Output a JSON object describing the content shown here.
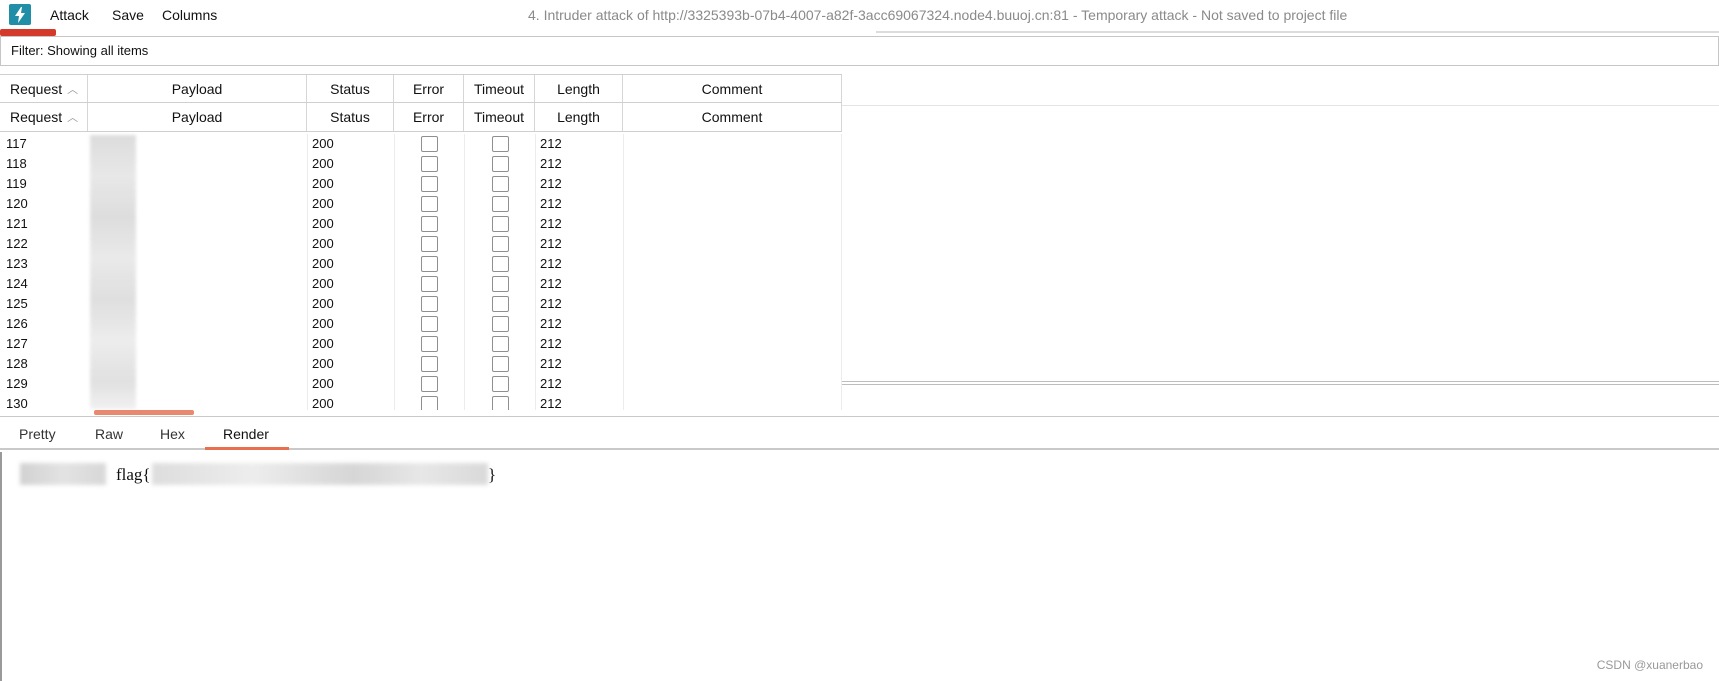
{
  "menubar": {
    "items": [
      "Attack",
      "Save",
      "Columns"
    ],
    "window_title": "4. Intruder attack of http://3325393b-07b4-4007-a82f-3acc69067324.node4.buuoj.cn:81 - Temporary attack - Not saved to project file"
  },
  "filter": {
    "label": "Filter: Showing all items"
  },
  "table": {
    "columns": [
      "Request",
      "Payload",
      "Status",
      "Error",
      "Timeout",
      "Length",
      "Comment"
    ],
    "sort_indicator": "^",
    "rows": [
      {
        "request": "117",
        "status": "200",
        "length": "212"
      },
      {
        "request": "118",
        "status": "200",
        "length": "212"
      },
      {
        "request": "119",
        "status": "200",
        "length": "212"
      },
      {
        "request": "120",
        "status": "200",
        "length": "212"
      },
      {
        "request": "121",
        "status": "200",
        "length": "212"
      },
      {
        "request": "122",
        "status": "200",
        "length": "212"
      },
      {
        "request": "123",
        "status": "200",
        "length": "212"
      },
      {
        "request": "124",
        "status": "200",
        "length": "212"
      },
      {
        "request": "125",
        "status": "200",
        "length": "212"
      },
      {
        "request": "126",
        "status": "200",
        "length": "212"
      },
      {
        "request": "127",
        "status": "200",
        "length": "212"
      },
      {
        "request": "128",
        "status": "200",
        "length": "212"
      },
      {
        "request": "129",
        "status": "200",
        "length": "212"
      },
      {
        "request": "130",
        "status": "200",
        "length": "212"
      }
    ]
  },
  "viewer": {
    "tabs": [
      "Pretty",
      "Raw",
      "Hex",
      "Render"
    ],
    "active_tab": "Render",
    "render_prefix": "flag{",
    "render_suffix": "}"
  },
  "watermark": "CSDN @xuanerbao",
  "colors": {
    "accent": "#e8704e",
    "menu_marker": "#d43a2a",
    "app_icon": "#1f8ea6"
  },
  "icons": {
    "app": "lightning-bolt-icon",
    "sort": "sort-ascending-icon"
  }
}
